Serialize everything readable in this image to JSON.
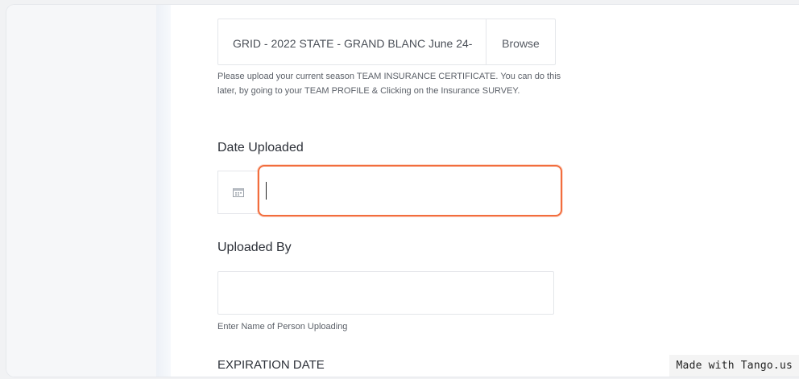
{
  "upload": {
    "file_name": "GRID - 2022 STATE - GRAND BLANC June 24-",
    "browse_label": "Browse",
    "help_text": "Please upload your current season TEAM INSURANCE CERTIFICATE. You can do this later, by going to your TEAM PROFILE & Clicking on the Insurance SURVEY."
  },
  "date_uploaded": {
    "label": "Date Uploaded",
    "value": "",
    "icon": "calendar-icon",
    "focus_color": "#f26d3d"
  },
  "uploaded_by": {
    "label": "Uploaded By",
    "value": "",
    "help_text": "Enter Name of Person Uploading"
  },
  "expiration_date": {
    "label": "EXPIRATION DATE"
  },
  "watermark": {
    "text": "Made with Tango.us"
  }
}
